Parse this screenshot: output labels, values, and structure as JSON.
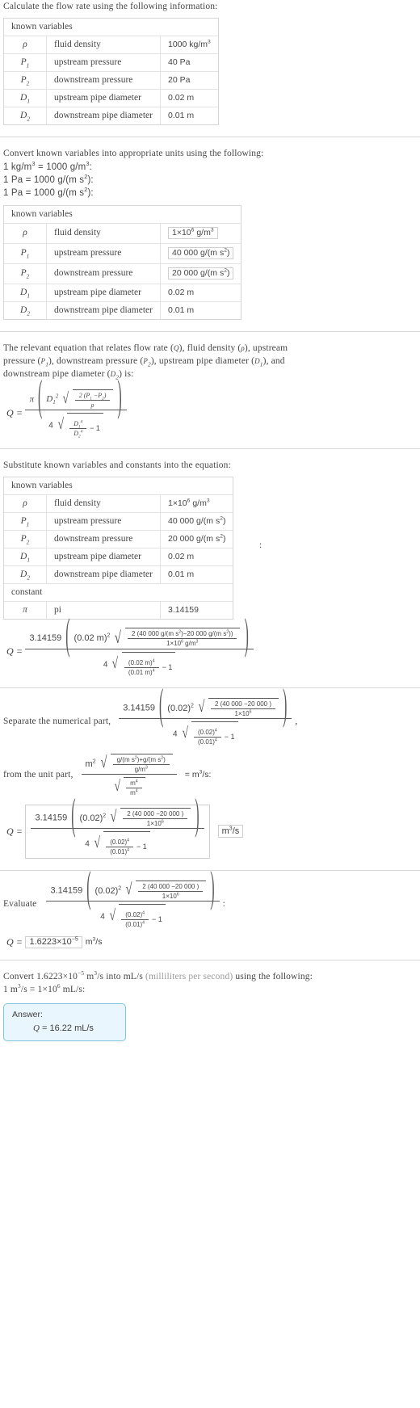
{
  "problem": {
    "prompt": "Calculate the flow rate using the following information:"
  },
  "table1": {
    "header": "known variables",
    "rows": [
      {
        "symbol": "ρ",
        "desc": "fluid density",
        "value": "1000 kg/m",
        "exp": "3"
      },
      {
        "symbol": "P",
        "sub": "1",
        "desc": "upstream pressure",
        "value": "40 Pa",
        "exp": ""
      },
      {
        "symbol": "P",
        "sub": "2",
        "desc": "downstream pressure",
        "value": "20 Pa",
        "exp": ""
      },
      {
        "symbol": "D",
        "sub": "1",
        "desc": "upstream pipe diameter",
        "value": "0.02 m",
        "exp": ""
      },
      {
        "symbol": "D",
        "sub": "2",
        "desc": "downstream pipe diameter",
        "value": "0.01 m",
        "exp": ""
      }
    ]
  },
  "convert": {
    "intro": "Convert known variables into appropriate units using the following:",
    "rule1_a": "1 kg/m",
    "rule1_a_exp": "3",
    "rule1_b": " = 1000 g/m",
    "rule1_b_exp": "3",
    "rule1_c": ":",
    "rule2": "1 Pa = 1000 g/(m s",
    "rule2_exp": "2",
    "rule2_end": "):",
    "rule3": "1 Pa = 1000 g/(m s",
    "rule3_exp": "2",
    "rule3_end": "):"
  },
  "table2": {
    "header": "known variables",
    "rows": [
      {
        "symbol": "ρ",
        "desc": "fluid density",
        "value_mantissa": "1×10",
        "value_exp": "6",
        "value_tail": " g/m",
        "value_tail_exp": "3",
        "boxed": true
      },
      {
        "symbol": "P",
        "sub": "1",
        "desc": "upstream pressure",
        "value_mantissa": "40 000 g/(m s",
        "value_exp": "",
        "value_tail": "",
        "value_tail_exp": "2",
        "boxed": true,
        "paren_close": ")"
      },
      {
        "symbol": "P",
        "sub": "2",
        "desc": "downstream pressure",
        "value_mantissa": "20 000 g/(m s",
        "value_exp": "",
        "value_tail": "",
        "value_tail_exp": "2",
        "boxed": true,
        "paren_close": ")"
      },
      {
        "symbol": "D",
        "sub": "1",
        "desc": "upstream pipe diameter",
        "value_mantissa": "0.02 m",
        "value_exp": "",
        "value_tail": "",
        "value_tail_exp": "",
        "boxed": false
      },
      {
        "symbol": "D",
        "sub": "2",
        "desc": "downstream pipe diameter",
        "value_mantissa": "0.01 m",
        "value_exp": "",
        "value_tail": "",
        "value_tail_exp": "",
        "boxed": false
      }
    ]
  },
  "equation_intro": {
    "line1_a": "The relevant equation that relates flow rate (",
    "line1_Q": "Q",
    "line1_b": "), fluid density (",
    "line1_rho": "ρ",
    "line1_c": "), upstream",
    "line2_a": "pressure (",
    "line2_P1": "P",
    "line2_P1sub": "1",
    "line2_b": "), downstream pressure (",
    "line2_P2": "P",
    "line2_P2sub": "2",
    "line2_c": "), upstream pipe diameter (",
    "line2_D1": "D",
    "line2_D1sub": "1",
    "line2_d": "), and",
    "line3_a": "downstream pipe diameter (",
    "line3_D2": "D",
    "line3_D2sub": "2",
    "line3_b": ") is:"
  },
  "symbolic_equation": {
    "lhs": "Q",
    "eq": "=",
    "pi": "π",
    "D1": "D",
    "D1_sub": "1",
    "D1_exp": "2",
    "inner_num": "2 (P",
    "inner_num_sub1": "1",
    "inner_num_mid": " −P",
    "inner_num_sub2": "2",
    "inner_num_end": ")",
    "inner_den": "ρ",
    "coef4": "4",
    "ratio_num": "D",
    "ratio_num_sub": "1",
    "ratio_num_exp": "4",
    "ratio_den": "D",
    "ratio_den_sub": "2",
    "ratio_den_exp": "4",
    "minus_one": "− 1"
  },
  "substitute": {
    "intro": "Substitute known variables and constants into the equation:",
    "colon": ":"
  },
  "table3": {
    "header": "known variables",
    "constant_header": "constant",
    "rows": [
      {
        "symbol": "ρ",
        "desc": "fluid density",
        "value": "1×10",
        "exp": "6",
        "tail": " g/m",
        "tail_exp": "3"
      },
      {
        "symbol": "P",
        "sub": "1",
        "desc": "upstream pressure",
        "value": "40 000 g/(m s",
        "exp": "",
        "tail": "",
        "tail_exp": "2",
        "close": ")"
      },
      {
        "symbol": "P",
        "sub": "2",
        "desc": "downstream pressure",
        "value": "20 000 g/(m s",
        "exp": "",
        "tail": "",
        "tail_exp": "2",
        "close": ")"
      },
      {
        "symbol": "D",
        "sub": "1",
        "desc": "upstream pipe diameter",
        "value": "0.02 m",
        "exp": "",
        "tail": "",
        "tail_exp": ""
      },
      {
        "symbol": "D",
        "sub": "2",
        "desc": "downstream pipe diameter",
        "value": "0.01 m",
        "exp": "",
        "tail": "",
        "tail_exp": ""
      }
    ],
    "constant_row": {
      "symbol": "π",
      "desc": "pi",
      "value": "3.14159"
    }
  },
  "substituted_equation": {
    "lhs": "Q",
    "eq": "=",
    "pi_num": "3.14159",
    "d1": "(0.02 m)",
    "d1_exp": "2",
    "inner_num_a": "2 (40 000  g/(m s",
    "inner_num_a_exp": "2",
    "inner_num_b": ")−20 000  g/(m s",
    "inner_num_b_exp": "2",
    "inner_num_c": "))",
    "inner_den_a": "1×10",
    "inner_den_exp": "6",
    "inner_den_b": "  g/m",
    "inner_den_b_exp": "3",
    "coef4": "4",
    "ratio_num": "(0.02 m)",
    "ratio_num_exp": "4",
    "ratio_den": "(0.01 m)",
    "ratio_den_exp": "4",
    "minus_one": "− 1"
  },
  "separate": {
    "label_numerical": "Separate the numerical part,",
    "comma": ",",
    "label_unit": "from the unit part,",
    "equals_unit": "= m",
    "equals_unit_exp": "3",
    "equals_unit_tail": "/s:",
    "numerical": {
      "pi_num": "3.14159",
      "d1": "(0.02)",
      "d1_exp": "2",
      "inner_num": "2 (40 000 −20 000 )",
      "inner_den": "1×10",
      "inner_den_exp": "6",
      "coef4": "4",
      "ratio_num": "(0.02)",
      "ratio_num_exp": "4",
      "ratio_den": "(0.01)",
      "ratio_den_exp": "4",
      "minus_one": "− 1"
    },
    "unit": {
      "m2": "m",
      "m2_exp": "2",
      "inner_num_a": "g/(m s",
      "inner_num_a_exp": "2",
      "inner_num_b": ")+g/(m s",
      "inner_num_b_exp": "2",
      "inner_num_c": ")",
      "inner_den": "g/m",
      "inner_den_exp": "3",
      "den_num": "m",
      "den_num_exp": "4",
      "den_den": "m",
      "den_den_exp": "4"
    }
  },
  "boxed_result": {
    "lhs": "Q",
    "eq": "=",
    "pi_num": "3.14159",
    "d1": "(0.02)",
    "d1_exp": "2",
    "inner_num": "2 (40 000 −20 000 )",
    "inner_den": "1×10",
    "inner_den_exp": "6",
    "coef4": "4",
    "ratio_num": "(0.02)",
    "ratio_num_exp": "4",
    "ratio_den": "(0.01)",
    "ratio_den_exp": "4",
    "minus_one": "− 1",
    "unit": "m",
    "unit_exp": "3",
    "unit_tail": "/s"
  },
  "evaluate": {
    "label": "Evaluate",
    "colon": ":",
    "pi_num": "3.14159",
    "d1": "(0.02)",
    "d1_exp": "2",
    "inner_num": "2 (40 000 −20 000 )",
    "inner_den": "1×10",
    "inner_den_exp": "6",
    "coef4": "4",
    "ratio_num": "(0.02)",
    "ratio_num_exp": "4",
    "ratio_den": "(0.01)",
    "ratio_den_exp": "4",
    "minus_one": "− 1",
    "result_lhs": "Q",
    "result_eq": "=",
    "result_mantissa": "1.6223×10",
    "result_exp": "−5",
    "result_unit": " m",
    "result_unit_exp": "3",
    "result_unit_tail": "/s"
  },
  "final_convert": {
    "line1_a": "Convert 1.6223×10",
    "line1_exp": "−5",
    "line1_b": " m",
    "line1_b_exp": "3",
    "line1_c": "/s into mL/s ",
    "line1_paren": "(milliliters per second)",
    "line1_d": " using the following:",
    "line2_a": "1 m",
    "line2_a_exp": "3",
    "line2_b": "/s = 1×10",
    "line2_b_exp": "6",
    "line2_c": " mL/s:"
  },
  "answer": {
    "label": "Answer:",
    "lhs": "Q",
    "eq": "=",
    "value": "16.22 mL/s"
  }
}
